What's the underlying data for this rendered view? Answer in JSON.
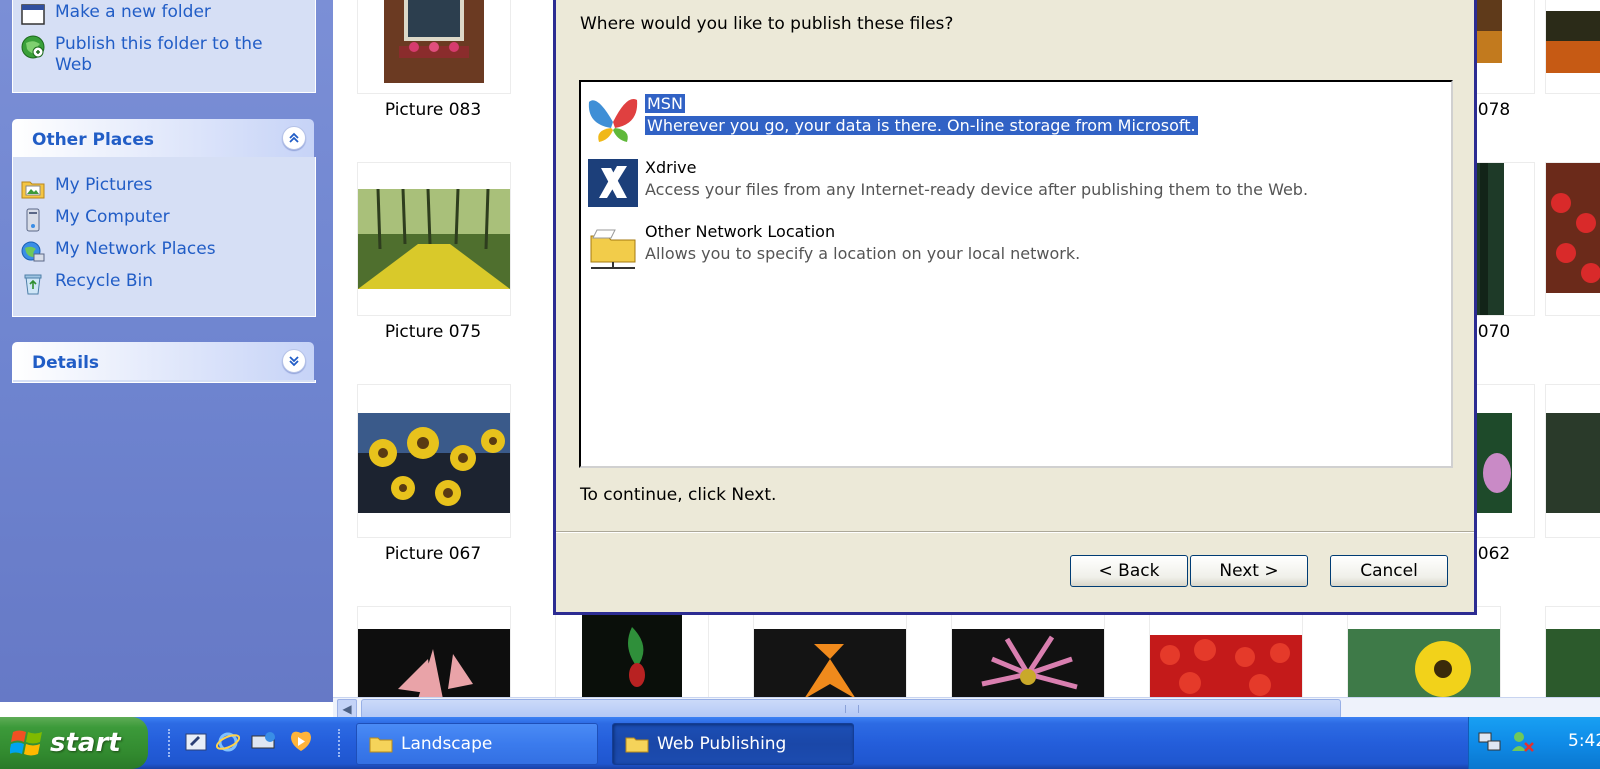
{
  "task_pane": {
    "picture_tasks": {
      "items": [
        {
          "label": "Make a new folder",
          "icon": "new-folder-icon"
        },
        {
          "label": "Publish this folder to the Web",
          "icon": "globe-icon"
        }
      ]
    },
    "other_places": {
      "title": "Other Places",
      "items": [
        {
          "label": "My Pictures",
          "icon": "my-pictures-icon"
        },
        {
          "label": "My Computer",
          "icon": "my-computer-icon"
        },
        {
          "label": "My Network Places",
          "icon": "network-places-icon"
        },
        {
          "label": "Recycle Bin",
          "icon": "recycle-bin-icon"
        }
      ]
    },
    "details": {
      "title": "Details"
    }
  },
  "thumbnails": {
    "labels": [
      "Picture 083",
      "Picture 075",
      "Picture 067",
      "078",
      "070",
      "062"
    ]
  },
  "dialog": {
    "question": "Where would you like to publish these files?",
    "providers": [
      {
        "name": "MSN",
        "description": "Wherever you go, your data is there.  On-line storage from Microsoft.",
        "icon": "msn-butterfly-icon",
        "selected": true
      },
      {
        "name": "Xdrive",
        "description": "Access your files from any Internet-ready device after publishing them to the Web.",
        "icon": "xdrive-icon",
        "selected": false
      },
      {
        "name": "Other Network Location",
        "description": "Allows you to specify a location on your local network.",
        "icon": "network-folder-icon",
        "selected": false
      }
    ],
    "hint": "To continue, click Next.",
    "buttons": {
      "back": "< Back",
      "next": "Next >",
      "cancel": "Cancel"
    }
  },
  "taskbar": {
    "start_label": "start",
    "windows": [
      {
        "label": "Landscape",
        "active": false
      },
      {
        "label": "Web Publishing",
        "active": true
      }
    ],
    "clock": "5:42"
  },
  "colors": {
    "task_pane_bg": "#6f85d0",
    "task_pane_link": "#215dc6",
    "selection": "#3162c5",
    "dialog_bg": "#ece9d8",
    "taskbar": "#245edb",
    "start_button": "#3c9a3a"
  }
}
